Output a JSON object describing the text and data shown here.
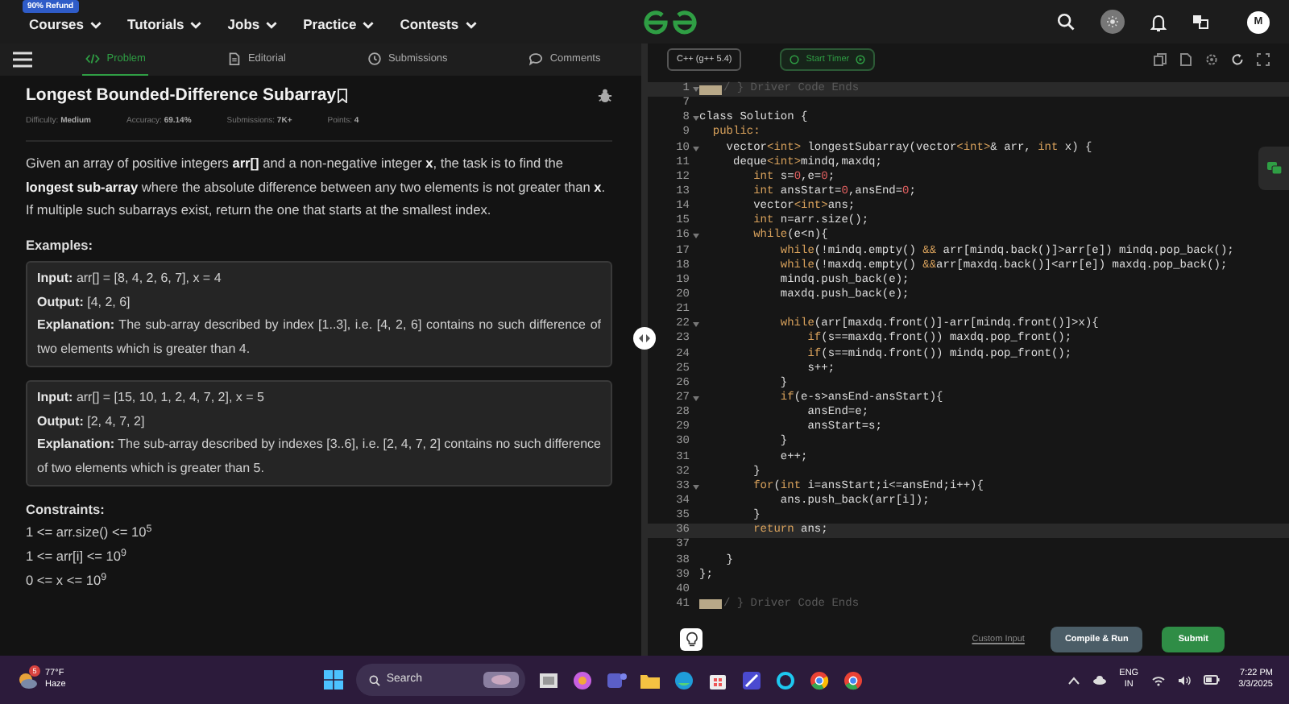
{
  "top_nav": {
    "badge": "90% Refund",
    "menus": [
      "Courses",
      "Tutorials",
      "Jobs",
      "Practice",
      "Contests"
    ],
    "avatar": "M"
  },
  "problem_tabs": [
    {
      "label": "Problem",
      "kind": "code",
      "selected": true
    },
    {
      "label": "Editorial",
      "kind": "doc",
      "selected": false
    },
    {
      "label": "Submissions",
      "kind": "clock",
      "selected": false
    },
    {
      "label": "Comments",
      "kind": "comment",
      "selected": false
    }
  ],
  "problem": {
    "title": "Longest Bounded-Difference Subarray",
    "meta": [
      {
        "label": "Difficulty:",
        "value": "Medium"
      },
      {
        "label": "Accuracy:",
        "value": "69.14%"
      },
      {
        "label": "Submissions:",
        "value": "7K+"
      },
      {
        "label": "Points:",
        "value": "4"
      }
    ],
    "description": [
      "Given an array of positive integers **arr[]** and a non-negative integer **x**, the task is to find the **longest sub-array** where the absolute difference between any two elements is not greater than **x**.",
      "If multiple such subarrays exist, return the one that starts at the smallest index."
    ],
    "examples_heading": "Examples:",
    "examples": [
      {
        "lines": [
          "**Input:** arr[] = [8, 4, 2, 6, 7], x = 4",
          "**Output:** [4, 2, 6]",
          "**Explanation:** The sub-array described by index [1..3], i.e. [4, 2, 6] contains no such difference of two elements which is greater than 4."
        ]
      },
      {
        "lines": [
          "**Input:** arr[] = [15, 10, 1, 2, 4, 7, 2], x = 5",
          "**Output:** [2, 4, 7, 2]",
          "**Explanation:** The sub-array described by indexes [3..6], i.e. [2, 4, 7, 2] contains no such difference of two elements which is greater than 5."
        ]
      }
    ],
    "constraints_heading": "Constraints:",
    "constraints": [
      "1 <= arr.size() <= 10$^{5}$",
      "1 <= arr[i] <= 10$^{9}$",
      "0 <= x <= 10$^{9}$"
    ]
  },
  "editor": {
    "language": "C++ (g++ 5.4)",
    "timer_button": "Start Timer",
    "lines": [
      {
        "number": "1",
        "fold": true,
        "folded": true,
        "highlighted": true,
        "tokens": [
          {
            "kind": "comment",
            "text": "/ } Driver Code Ends"
          }
        ]
      },
      {
        "number": "7",
        "fold": false,
        "folded": false,
        "highlighted": false
      },
      {
        "number": "8",
        "fold": true,
        "folded": false,
        "highlighted": false,
        "tokens": [
          {
            "kind": "plain",
            "text": "class Solution {"
          }
        ]
      },
      {
        "number": "9",
        "fold": false,
        "folded": false,
        "highlighted": false,
        "tokens": [
          {
            "kind": "kw",
            "text": "  public:"
          }
        ]
      },
      {
        "number": "10",
        "fold": true,
        "folded": false,
        "highlighted": false,
        "tokens": [
          {
            "kind": "plain",
            "text": "    vector"
          },
          {
            "kind": "kw",
            "text": "<int>"
          },
          {
            "kind": "plain",
            "text": " longestSubarray(vector"
          },
          {
            "kind": "kw",
            "text": "<int>"
          },
          {
            "kind": "plain",
            "text": "& arr, "
          },
          {
            "kind": "kw",
            "text": "int"
          },
          {
            "kind": "plain",
            "text": " x) {"
          }
        ]
      },
      {
        "number": "11",
        "fold": false,
        "folded": false,
        "highlighted": false,
        "tokens": [
          {
            "kind": "plain",
            "text": "     deque"
          },
          {
            "kind": "kw",
            "text": "<int>"
          },
          {
            "kind": "plain",
            "text": "mindq,maxdq;"
          }
        ]
      },
      {
        "number": "12",
        "fold": false,
        "folded": false,
        "highlighted": false,
        "tokens": [
          {
            "kind": "kw",
            "text": "        int"
          },
          {
            "kind": "plain",
            "text": " s="
          },
          {
            "kind": "num",
            "text": "0"
          },
          {
            "kind": "plain",
            "text": ",e="
          },
          {
            "kind": "num",
            "text": "0"
          },
          {
            "kind": "plain",
            "text": ";"
          }
        ]
      },
      {
        "number": "13",
        "fold": false,
        "folded": false,
        "highlighted": false,
        "tokens": [
          {
            "kind": "kw",
            "text": "        int"
          },
          {
            "kind": "plain",
            "text": " ansStart="
          },
          {
            "kind": "num",
            "text": "0"
          },
          {
            "kind": "plain",
            "text": ",ansEnd="
          },
          {
            "kind": "num",
            "text": "0"
          },
          {
            "kind": "plain",
            "text": ";"
          }
        ]
      },
      {
        "number": "14",
        "fold": false,
        "folded": false,
        "highlighted": false,
        "tokens": [
          {
            "kind": "plain",
            "text": "        vector"
          },
          {
            "kind": "kw",
            "text": "<int>"
          },
          {
            "kind": "plain",
            "text": "ans;"
          }
        ]
      },
      {
        "number": "15",
        "fold": false,
        "folded": false,
        "highlighted": false,
        "tokens": [
          {
            "kind": "kw",
            "text": "        int"
          },
          {
            "kind": "plain",
            "text": " n=arr.size();"
          }
        ]
      },
      {
        "number": "16",
        "fold": true,
        "folded": false,
        "highlighted": false,
        "tokens": [
          {
            "kind": "kw",
            "text": "        while"
          },
          {
            "kind": "plain",
            "text": "(e<n){"
          }
        ]
      },
      {
        "number": "17",
        "fold": false,
        "folded": false,
        "highlighted": false,
        "tokens": [
          {
            "kind": "kw",
            "text": "            while"
          },
          {
            "kind": "plain",
            "text": "(!mindq.empty() "
          },
          {
            "kind": "kw",
            "text": "&&"
          },
          {
            "kind": "plain",
            "text": " arr[mindq.back()]>arr[e]) mindq.pop_back();"
          }
        ]
      },
      {
        "number": "18",
        "fold": false,
        "folded": false,
        "highlighted": false,
        "tokens": [
          {
            "kind": "kw",
            "text": "            while"
          },
          {
            "kind": "plain",
            "text": "(!maxdq.empty() "
          },
          {
            "kind": "kw",
            "text": "&&"
          },
          {
            "kind": "plain",
            "text": "arr[maxdq.back()]<arr[e]) maxdq.pop_back();"
          }
        ]
      },
      {
        "number": "19",
        "fold": false,
        "folded": false,
        "highlighted": false,
        "tokens": [
          {
            "kind": "plain",
            "text": "            mindq.push_back(e);"
          }
        ]
      },
      {
        "number": "20",
        "fold": false,
        "folded": false,
        "highlighted": false,
        "tokens": [
          {
            "kind": "plain",
            "text": "            maxdq.push_back(e);"
          }
        ]
      },
      {
        "number": "21",
        "fold": false,
        "folded": false,
        "highlighted": false
      },
      {
        "number": "22",
        "fold": true,
        "folded": false,
        "highlighted": false,
        "tokens": [
          {
            "kind": "kw",
            "text": "            while"
          },
          {
            "kind": "plain",
            "text": "(arr[maxdq.front()]-arr[mindq.front()]>x){"
          }
        ]
      },
      {
        "number": "23",
        "fold": false,
        "folded": false,
        "highlighted": false,
        "tokens": [
          {
            "kind": "kw",
            "text": "                if"
          },
          {
            "kind": "plain",
            "text": "(s==maxdq.front()) maxdq.pop_front();"
          }
        ]
      },
      {
        "number": "24",
        "fold": false,
        "folded": false,
        "highlighted": false,
        "tokens": [
          {
            "kind": "kw",
            "text": "                if"
          },
          {
            "kind": "plain",
            "text": "(s==mindq.front()) mindq.pop_front();"
          }
        ]
      },
      {
        "number": "25",
        "fold": false,
        "folded": false,
        "highlighted": false,
        "tokens": [
          {
            "kind": "plain",
            "text": "                s++;"
          }
        ]
      },
      {
        "number": "26",
        "fold": false,
        "folded": false,
        "highlighted": false,
        "tokens": [
          {
            "kind": "plain",
            "text": "            }"
          }
        ]
      },
      {
        "number": "27",
        "fold": true,
        "folded": false,
        "highlighted": false,
        "tokens": [
          {
            "kind": "kw",
            "text": "            if"
          },
          {
            "kind": "plain",
            "text": "(e-s>ansEnd-ansStart){"
          }
        ]
      },
      {
        "number": "28",
        "fold": false,
        "folded": false,
        "highlighted": false,
        "tokens": [
          {
            "kind": "plain",
            "text": "                ansEnd=e;"
          }
        ]
      },
      {
        "number": "29",
        "fold": false,
        "folded": false,
        "highlighted": false,
        "tokens": [
          {
            "kind": "plain",
            "text": "                ansStart=s;"
          }
        ]
      },
      {
        "number": "30",
        "fold": false,
        "folded": false,
        "highlighted": false,
        "tokens": [
          {
            "kind": "plain",
            "text": "            }"
          }
        ]
      },
      {
        "number": "31",
        "fold": false,
        "folded": false,
        "highlighted": false,
        "tokens": [
          {
            "kind": "plain",
            "text": "            e++;"
          }
        ]
      },
      {
        "number": "32",
        "fold": false,
        "folded": false,
        "highlighted": false,
        "tokens": [
          {
            "kind": "plain",
            "text": "        }"
          }
        ]
      },
      {
        "number": "33",
        "fold": true,
        "folded": false,
        "highlighted": false,
        "tokens": [
          {
            "kind": "kw",
            "text": "        for"
          },
          {
            "kind": "plain",
            "text": "("
          },
          {
            "kind": "kw",
            "text": "int"
          },
          {
            "kind": "plain",
            "text": " i=ansStart;i<=ansEnd;i++){"
          }
        ]
      },
      {
        "number": "34",
        "fold": false,
        "folded": false,
        "highlighted": false,
        "tokens": [
          {
            "kind": "plain",
            "text": "            ans.push_back(arr[i]);"
          }
        ]
      },
      {
        "number": "35",
        "fold": false,
        "folded": false,
        "highlighted": false,
        "tokens": [
          {
            "kind": "plain",
            "text": "        }"
          }
        ]
      },
      {
        "number": "36",
        "fold": false,
        "folded": false,
        "highlighted": true,
        "tokens": [
          {
            "kind": "kw",
            "text": "        return"
          },
          {
            "kind": "plain",
            "text": " ans;"
          }
        ]
      },
      {
        "number": "37",
        "fold": false,
        "folded": false,
        "highlighted": false
      },
      {
        "number": "38",
        "fold": false,
        "folded": false,
        "highlighted": false,
        "tokens": [
          {
            "kind": "plain",
            "text": "    }"
          }
        ]
      },
      {
        "number": "39",
        "fold": false,
        "folded": false,
        "highlighted": false,
        "tokens": [
          {
            "kind": "plain",
            "text": "};"
          }
        ]
      },
      {
        "number": "40",
        "fold": false,
        "folded": false,
        "highlighted": false
      },
      {
        "number": "41",
        "fold": false,
        "folded": true,
        "highlighted": false,
        "tokens": [
          {
            "kind": "comment",
            "text": "/ } Driver Code Ends"
          }
        ]
      }
    ],
    "footer": {
      "custom_input": "Custom Input",
      "compile_button": "Compile & Run",
      "submit_button": "Submit"
    }
  },
  "taskbar": {
    "weather_badge": "5",
    "temperature": "77°F",
    "condition": "Haze",
    "search": "Search",
    "language": "ENG",
    "region": "IN",
    "time": "7:22 PM",
    "date": "3/3/2025"
  }
}
